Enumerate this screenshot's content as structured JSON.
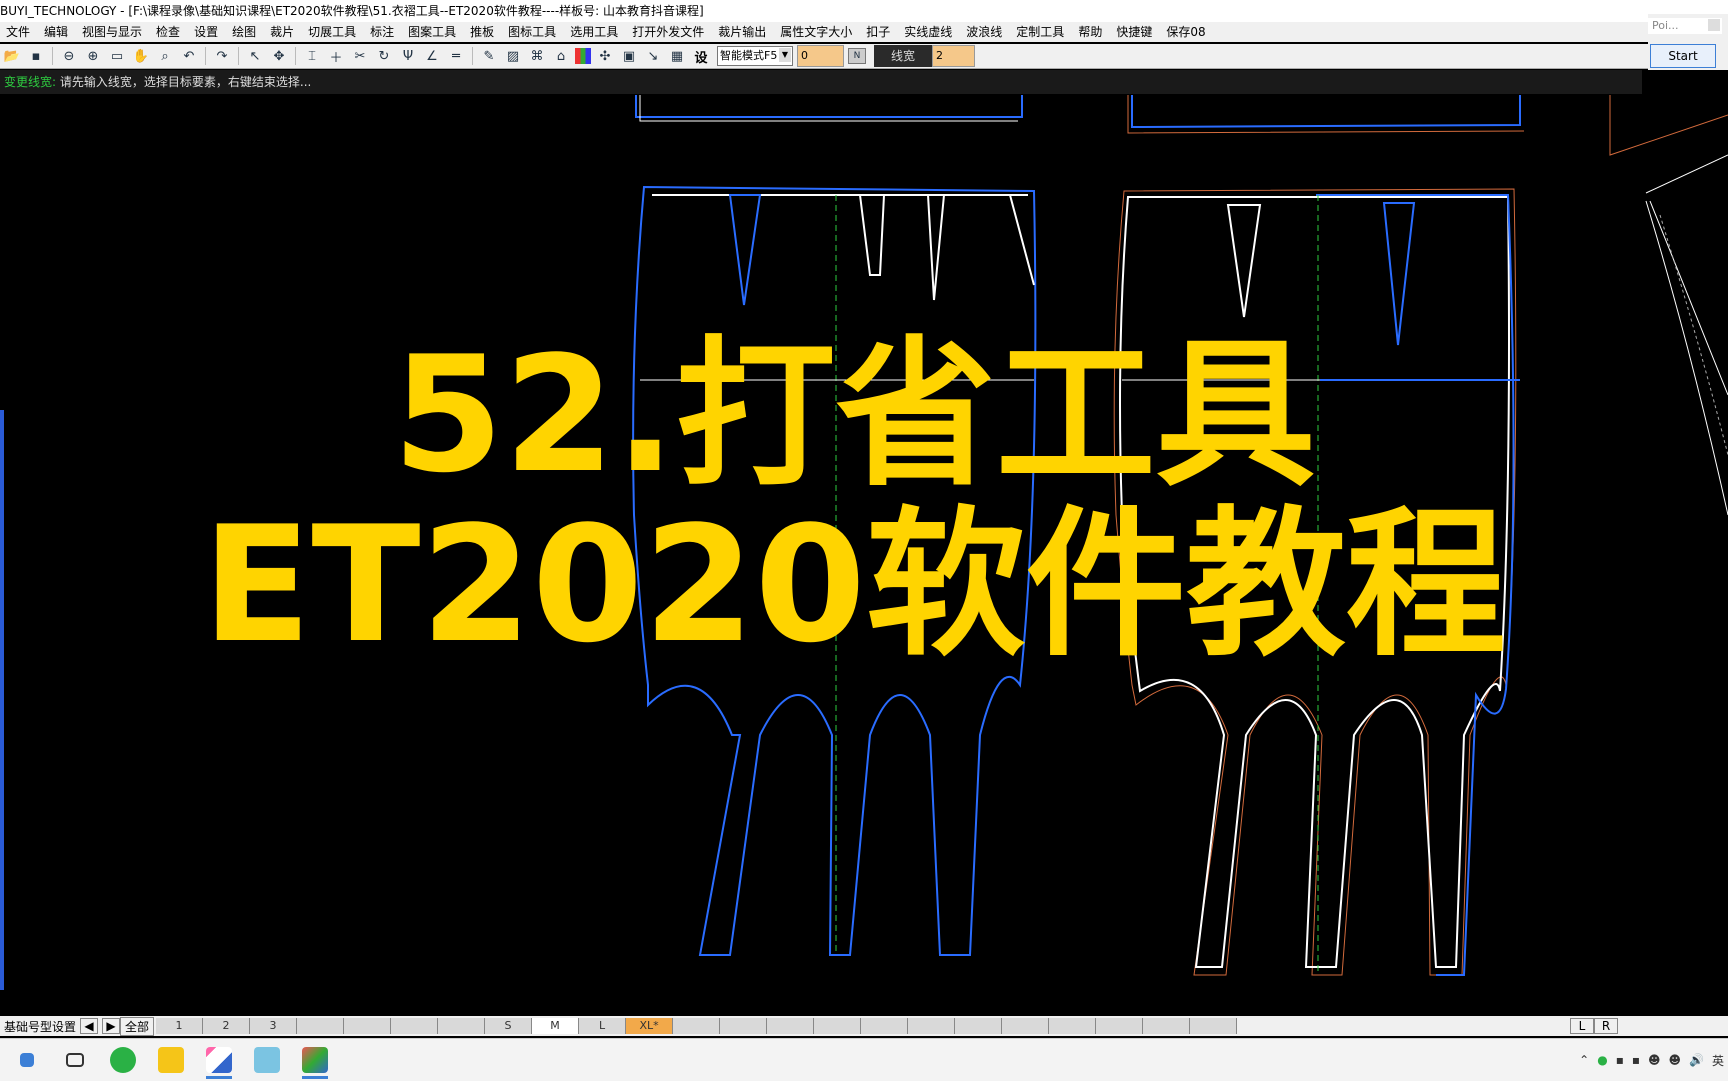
{
  "window": {
    "title": "BUYI_TECHNOLOGY - [F:\\课程录像\\基础知识课程\\ET2020软件教程\\51.衣褶工具--ET2020软件教程----样板号: 山本教育抖音课程]"
  },
  "menu": [
    "文件",
    "编辑",
    "视图与显示",
    "检查",
    "设置",
    "绘图",
    "裁片",
    "切展工具",
    "标注",
    "图案工具",
    "推板",
    "图标工具",
    "选用工具",
    "打开外发文件",
    "裁片输出",
    "属性文字大小",
    "扣子",
    "实线虚线",
    "波浪线",
    "定制工具",
    "帮助",
    "快捷键",
    "保存08"
  ],
  "toolbar": {
    "mode_select": "智能模式F5",
    "field_a": "0",
    "linewidth_label": "线宽",
    "linewidth_value": "2",
    "settings_glyph": "设"
  },
  "start_panel": {
    "poi_label": "Poi...",
    "start_label": "Start"
  },
  "status": {
    "command": "变更线宽:",
    "prompt": "请先输入线宽，选择目标要素，右键结束选择..."
  },
  "overlay": {
    "line1": "52.打省工具",
    "line2": "ET2020软件教程"
  },
  "sizebar": {
    "label": "基础号型设置",
    "all_label": "全部",
    "sizes": [
      "1",
      "2",
      "3",
      "",
      "",
      "",
      "",
      "S",
      "M",
      "L",
      "XL*",
      "",
      "",
      "",
      "",
      "",
      "",
      "",
      "",
      "",
      "",
      "",
      ""
    ],
    "active_size": "M",
    "highlight_size": "XL*",
    "right_labels": [
      "L",
      "R"
    ]
  },
  "colors": {
    "overlay_text": "#ffd400",
    "pattern_blue": "#2a6cff",
    "pattern_white": "#ffffff",
    "pattern_orange": "#d26a3c",
    "status_green": "#2ecc40"
  },
  "taskbar": {
    "icons": [
      "windows-start-icon",
      "task-view-icon",
      "wechat-icon",
      "file-explorer-icon",
      "et-software-icon",
      "app-icon-2",
      "app-icon-3"
    ],
    "tray_lang": "英"
  }
}
